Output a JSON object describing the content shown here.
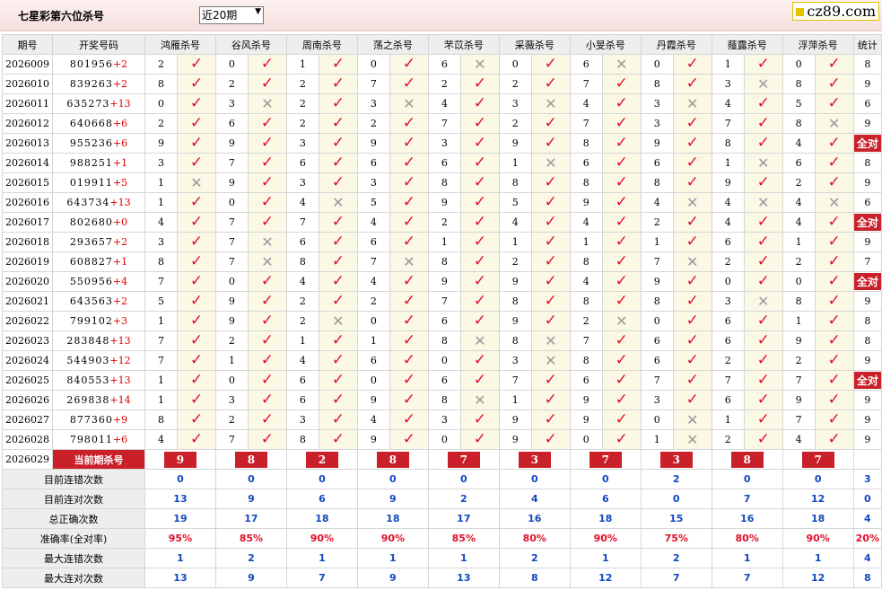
{
  "header": {
    "title": "七星彩第六位杀号",
    "period_select": "近20期",
    "logo": "cz89.com"
  },
  "columns": {
    "period": "期号",
    "draw": "开奖号码",
    "stat": "统计"
  },
  "experts": [
    "鸿雁杀号",
    "谷风杀号",
    "周南杀号",
    "荡之杀号",
    "芣苡杀号",
    "采薇杀号",
    "小旻杀号",
    "丹霞杀号",
    "薤露杀号",
    "浮萍杀号"
  ],
  "rows": [
    {
      "period": "2026009",
      "numbers": "801956",
      "offset": "+2",
      "kills": [
        [
          2,
          1
        ],
        [
          0,
          1
        ],
        [
          1,
          1
        ],
        [
          0,
          1
        ],
        [
          6,
          0
        ],
        [
          0,
          1
        ],
        [
          6,
          0
        ],
        [
          0,
          1
        ],
        [
          1,
          1
        ],
        [
          0,
          1
        ]
      ],
      "stat": "8"
    },
    {
      "period": "2026010",
      "numbers": "839263",
      "offset": "+2",
      "kills": [
        [
          8,
          1
        ],
        [
          2,
          1
        ],
        [
          2,
          1
        ],
        [
          7,
          1
        ],
        [
          2,
          1
        ],
        [
          2,
          1
        ],
        [
          7,
          1
        ],
        [
          8,
          1
        ],
        [
          3,
          0
        ],
        [
          8,
          1
        ]
      ],
      "stat": "9"
    },
    {
      "period": "2026011",
      "numbers": "635273",
      "offset": "+13",
      "kills": [
        [
          0,
          1
        ],
        [
          3,
          0
        ],
        [
          2,
          1
        ],
        [
          3,
          0
        ],
        [
          4,
          1
        ],
        [
          3,
          0
        ],
        [
          4,
          1
        ],
        [
          3,
          0
        ],
        [
          4,
          1
        ],
        [
          5,
          1
        ]
      ],
      "stat": "6"
    },
    {
      "period": "2026012",
      "numbers": "640668",
      "offset": "+6",
      "kills": [
        [
          2,
          1
        ],
        [
          6,
          1
        ],
        [
          2,
          1
        ],
        [
          2,
          1
        ],
        [
          7,
          1
        ],
        [
          2,
          1
        ],
        [
          7,
          1
        ],
        [
          3,
          1
        ],
        [
          7,
          1
        ],
        [
          8,
          0
        ]
      ],
      "stat": "9"
    },
    {
      "period": "2026013",
      "numbers": "955236",
      "offset": "+6",
      "kills": [
        [
          9,
          1
        ],
        [
          9,
          1
        ],
        [
          3,
          1
        ],
        [
          9,
          1
        ],
        [
          3,
          1
        ],
        [
          9,
          1
        ],
        [
          8,
          1
        ],
        [
          9,
          1
        ],
        [
          8,
          1
        ],
        [
          4,
          1
        ]
      ],
      "stat": "全对"
    },
    {
      "period": "2026014",
      "numbers": "988251",
      "offset": "+1",
      "kills": [
        [
          3,
          1
        ],
        [
          7,
          1
        ],
        [
          6,
          1
        ],
        [
          6,
          1
        ],
        [
          6,
          1
        ],
        [
          1,
          0
        ],
        [
          6,
          1
        ],
        [
          6,
          1
        ],
        [
          1,
          0
        ],
        [
          6,
          1
        ]
      ],
      "stat": "8"
    },
    {
      "period": "2026015",
      "numbers": "019911",
      "offset": "+5",
      "kills": [
        [
          1,
          0
        ],
        [
          9,
          1
        ],
        [
          3,
          1
        ],
        [
          3,
          1
        ],
        [
          8,
          1
        ],
        [
          8,
          1
        ],
        [
          8,
          1
        ],
        [
          8,
          1
        ],
        [
          9,
          1
        ],
        [
          2,
          1
        ]
      ],
      "stat": "9"
    },
    {
      "period": "2026016",
      "numbers": "643734",
      "offset": "+13",
      "kills": [
        [
          1,
          1
        ],
        [
          0,
          1
        ],
        [
          4,
          0
        ],
        [
          5,
          1
        ],
        [
          9,
          1
        ],
        [
          5,
          1
        ],
        [
          9,
          1
        ],
        [
          4,
          0
        ],
        [
          4,
          0
        ],
        [
          4,
          0
        ]
      ],
      "stat": "6"
    },
    {
      "period": "2026017",
      "numbers": "802680",
      "offset": "+0",
      "kills": [
        [
          4,
          1
        ],
        [
          7,
          1
        ],
        [
          7,
          1
        ],
        [
          4,
          1
        ],
        [
          2,
          1
        ],
        [
          4,
          1
        ],
        [
          4,
          1
        ],
        [
          2,
          1
        ],
        [
          4,
          1
        ],
        [
          4,
          1
        ]
      ],
      "stat": "全对"
    },
    {
      "period": "2026018",
      "numbers": "293657",
      "offset": "+2",
      "kills": [
        [
          3,
          1
        ],
        [
          7,
          0
        ],
        [
          6,
          1
        ],
        [
          6,
          1
        ],
        [
          1,
          1
        ],
        [
          1,
          1
        ],
        [
          1,
          1
        ],
        [
          1,
          1
        ],
        [
          6,
          1
        ],
        [
          1,
          1
        ]
      ],
      "stat": "9"
    },
    {
      "period": "2026019",
      "numbers": "608827",
      "offset": "+1",
      "kills": [
        [
          8,
          1
        ],
        [
          7,
          0
        ],
        [
          8,
          1
        ],
        [
          7,
          0
        ],
        [
          8,
          1
        ],
        [
          2,
          1
        ],
        [
          8,
          1
        ],
        [
          7,
          0
        ],
        [
          2,
          1
        ],
        [
          2,
          1
        ]
      ],
      "stat": "7"
    },
    {
      "period": "2026020",
      "numbers": "550956",
      "offset": "+4",
      "kills": [
        [
          7,
          1
        ],
        [
          0,
          1
        ],
        [
          4,
          1
        ],
        [
          4,
          1
        ],
        [
          9,
          1
        ],
        [
          9,
          1
        ],
        [
          4,
          1
        ],
        [
          9,
          1
        ],
        [
          0,
          1
        ],
        [
          0,
          1
        ]
      ],
      "stat": "全对"
    },
    {
      "period": "2026021",
      "numbers": "643563",
      "offset": "+2",
      "kills": [
        [
          5,
          1
        ],
        [
          9,
          1
        ],
        [
          2,
          1
        ],
        [
          2,
          1
        ],
        [
          7,
          1
        ],
        [
          8,
          1
        ],
        [
          8,
          1
        ],
        [
          8,
          1
        ],
        [
          3,
          0
        ],
        [
          8,
          1
        ]
      ],
      "stat": "9"
    },
    {
      "period": "2026022",
      "numbers": "799102",
      "offset": "+3",
      "kills": [
        [
          1,
          1
        ],
        [
          9,
          1
        ],
        [
          2,
          0
        ],
        [
          0,
          1
        ],
        [
          6,
          1
        ],
        [
          9,
          1
        ],
        [
          2,
          0
        ],
        [
          0,
          1
        ],
        [
          6,
          1
        ],
        [
          1,
          1
        ]
      ],
      "stat": "8"
    },
    {
      "period": "2026023",
      "numbers": "283848",
      "offset": "+13",
      "kills": [
        [
          7,
          1
        ],
        [
          2,
          1
        ],
        [
          1,
          1
        ],
        [
          1,
          1
        ],
        [
          8,
          0
        ],
        [
          8,
          0
        ],
        [
          7,
          1
        ],
        [
          6,
          1
        ],
        [
          6,
          1
        ],
        [
          9,
          1
        ]
      ],
      "stat": "8"
    },
    {
      "period": "2026024",
      "numbers": "544903",
      "offset": "+12",
      "kills": [
        [
          7,
          1
        ],
        [
          1,
          1
        ],
        [
          4,
          1
        ],
        [
          6,
          1
        ],
        [
          0,
          1
        ],
        [
          3,
          0
        ],
        [
          8,
          1
        ],
        [
          6,
          1
        ],
        [
          2,
          1
        ],
        [
          2,
          1
        ]
      ],
      "stat": "9"
    },
    {
      "period": "2026025",
      "numbers": "840553",
      "offset": "+13",
      "kills": [
        [
          1,
          1
        ],
        [
          0,
          1
        ],
        [
          6,
          1
        ],
        [
          0,
          1
        ],
        [
          6,
          1
        ],
        [
          7,
          1
        ],
        [
          6,
          1
        ],
        [
          7,
          1
        ],
        [
          7,
          1
        ],
        [
          7,
          1
        ]
      ],
      "stat": "全对"
    },
    {
      "period": "2026026",
      "numbers": "269838",
      "offset": "+14",
      "kills": [
        [
          1,
          1
        ],
        [
          3,
          1
        ],
        [
          6,
          1
        ],
        [
          9,
          1
        ],
        [
          8,
          0
        ],
        [
          1,
          1
        ],
        [
          9,
          1
        ],
        [
          3,
          1
        ],
        [
          6,
          1
        ],
        [
          9,
          1
        ]
      ],
      "stat": "9"
    },
    {
      "period": "2026027",
      "numbers": "877360",
      "offset": "+9",
      "kills": [
        [
          8,
          1
        ],
        [
          2,
          1
        ],
        [
          3,
          1
        ],
        [
          4,
          1
        ],
        [
          3,
          1
        ],
        [
          9,
          1
        ],
        [
          9,
          1
        ],
        [
          0,
          0
        ],
        [
          1,
          1
        ],
        [
          7,
          1
        ]
      ],
      "stat": "9"
    },
    {
      "period": "2026028",
      "numbers": "798011",
      "offset": "+6",
      "kills": [
        [
          4,
          1
        ],
        [
          7,
          1
        ],
        [
          8,
          1
        ],
        [
          9,
          1
        ],
        [
          0,
          1
        ],
        [
          9,
          1
        ],
        [
          0,
          1
        ],
        [
          1,
          0
        ],
        [
          2,
          1
        ],
        [
          4,
          1
        ]
      ],
      "stat": "9"
    }
  ],
  "current": {
    "period": "2026029",
    "label": "当前期杀号",
    "kills": [
      "9",
      "8",
      "2",
      "8",
      "7",
      "3",
      "7",
      "3",
      "8",
      "7"
    ]
  },
  "stats": [
    {
      "label": "目前连错次数",
      "color": "blue",
      "values": [
        "0",
        "0",
        "0",
        "0",
        "0",
        "0",
        "0",
        "2",
        "0",
        "0",
        "3"
      ]
    },
    {
      "label": "目前连对次数",
      "color": "blue",
      "values": [
        "13",
        "9",
        "6",
        "9",
        "2",
        "4",
        "6",
        "0",
        "7",
        "12",
        "0"
      ]
    },
    {
      "label": "总正确次数",
      "color": "blue",
      "values": [
        "19",
        "17",
        "18",
        "18",
        "17",
        "16",
        "18",
        "15",
        "16",
        "18",
        "4"
      ]
    },
    {
      "label": "准确率(全对率)",
      "color": "red",
      "values": [
        "95%",
        "85%",
        "90%",
        "90%",
        "85%",
        "80%",
        "90%",
        "75%",
        "80%",
        "90%",
        "20%"
      ]
    },
    {
      "label": "最大连错次数",
      "color": "blue",
      "values": [
        "1",
        "2",
        "1",
        "1",
        "1",
        "2",
        "1",
        "2",
        "1",
        "1",
        "4"
      ]
    },
    {
      "label": "最大连对次数",
      "color": "blue",
      "values": [
        "13",
        "9",
        "7",
        "9",
        "13",
        "8",
        "12",
        "7",
        "7",
        "12",
        "8"
      ]
    }
  ],
  "marks": {
    "ok": "✓",
    "no": "✕"
  },
  "colors": {
    "accent": "#c9202a",
    "check": "#e0102a",
    "stat_blue": "#1248c0",
    "mark_bg": "#fbf8e6"
  }
}
